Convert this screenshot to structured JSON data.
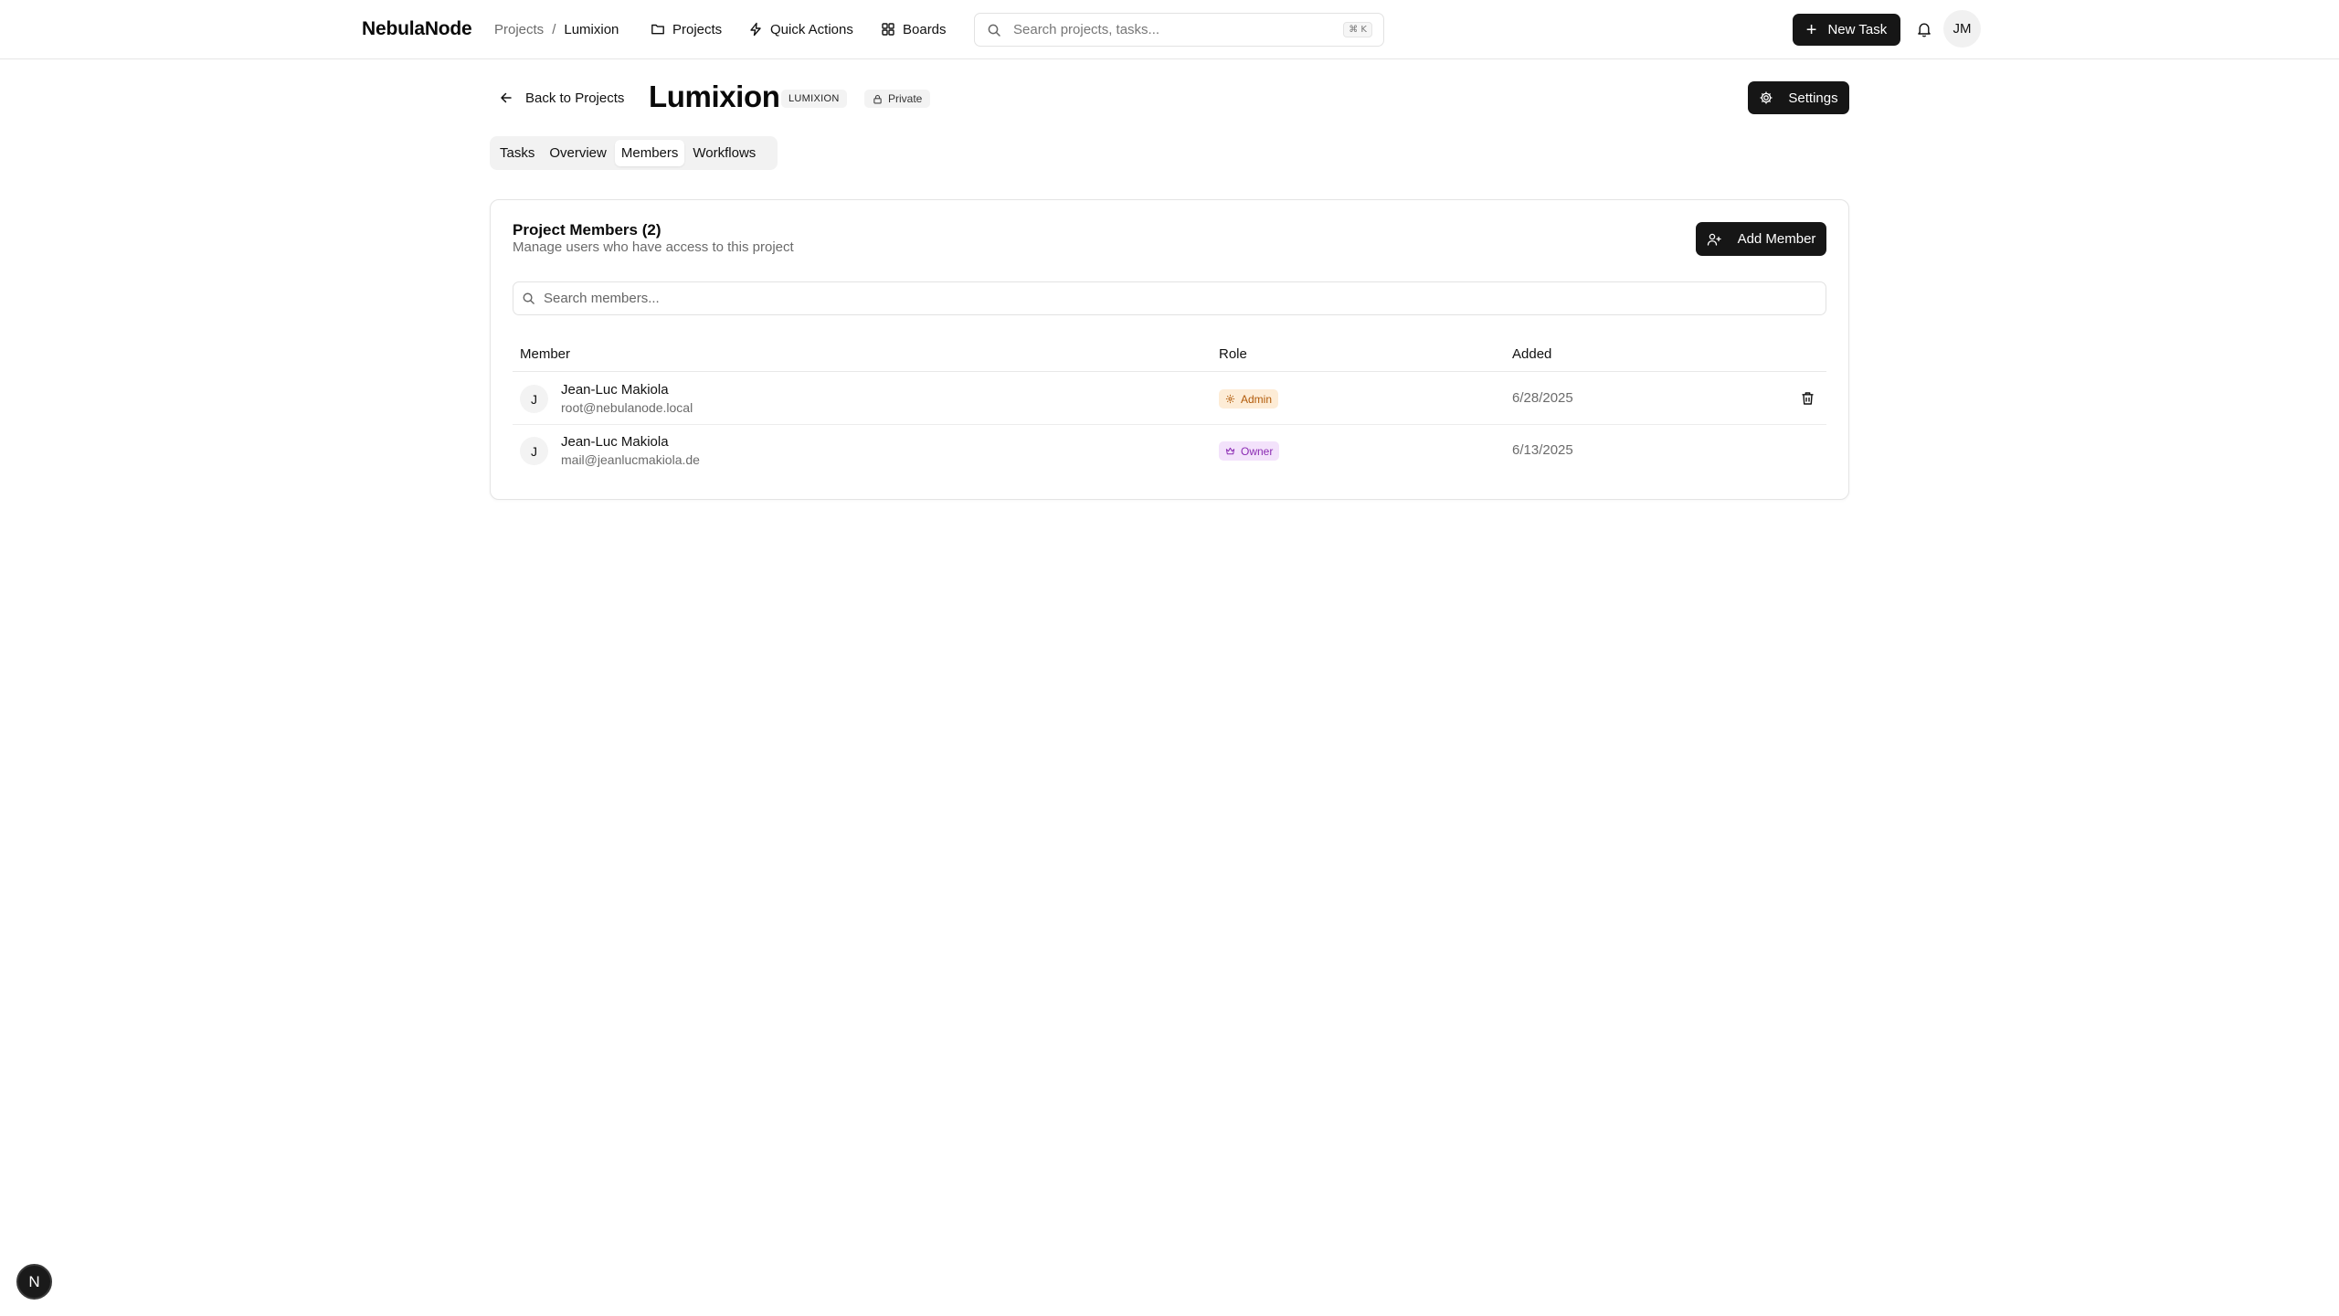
{
  "app": {
    "brand": "NebulaNode"
  },
  "breadcrumb": {
    "parent": "Projects",
    "separator": "/",
    "current": "Lumixion"
  },
  "nav": {
    "projects": "Projects",
    "quick_actions": "Quick Actions",
    "boards": "Boards"
  },
  "search": {
    "placeholder": "Search projects, tasks...",
    "shortcut": "⌘ K"
  },
  "header_actions": {
    "new_task": "New Task",
    "avatar_initials": "JM"
  },
  "project": {
    "back_label": "Back to Projects",
    "title": "Lumixion",
    "key": "LUMIXION",
    "visibility": "Private",
    "settings_label": "Settings"
  },
  "tabs": [
    {
      "label": "Tasks",
      "active": false
    },
    {
      "label": "Overview",
      "active": false
    },
    {
      "label": "Members",
      "active": true
    },
    {
      "label": "Workflows",
      "active": false
    }
  ],
  "members_card": {
    "title": "Project Members (2)",
    "subtitle": "Manage users who have access to this project",
    "add_label": "Add Member",
    "search_placeholder": "Search members...",
    "columns": {
      "member": "Member",
      "role": "Role",
      "added": "Added"
    },
    "rows": [
      {
        "initial": "J",
        "name": "Jean-Luc Makiola",
        "email": "root@nebulanode.local",
        "role": "Admin",
        "added": "6/28/2025",
        "removable": true
      },
      {
        "initial": "J",
        "name": "Jean-Luc Makiola",
        "email": "mail@jeanlucmakiola.de",
        "role": "Owner",
        "added": "6/13/2025",
        "removable": false
      }
    ]
  },
  "fab": {
    "label": "N"
  },
  "colors": {
    "primary_button": "#161616",
    "admin_badge_bg": "#fdecd6",
    "admin_badge_text": "#b15a09",
    "owner_badge_bg": "#f3e2fb",
    "owner_badge_text": "#8b2cb3"
  },
  "icons": {
    "nav_projects": "folder-icon",
    "nav_quick_actions": "lightning-icon",
    "nav_boards": "grid-icon",
    "search": "search-icon",
    "notifications": "bell-icon",
    "back": "arrow-left-icon",
    "visibility": "lock-icon",
    "settings": "gear-icon",
    "add_member": "user-plus-icon",
    "admin_role": "shield-icon",
    "owner_role": "crown-icon",
    "remove": "trash-icon"
  }
}
